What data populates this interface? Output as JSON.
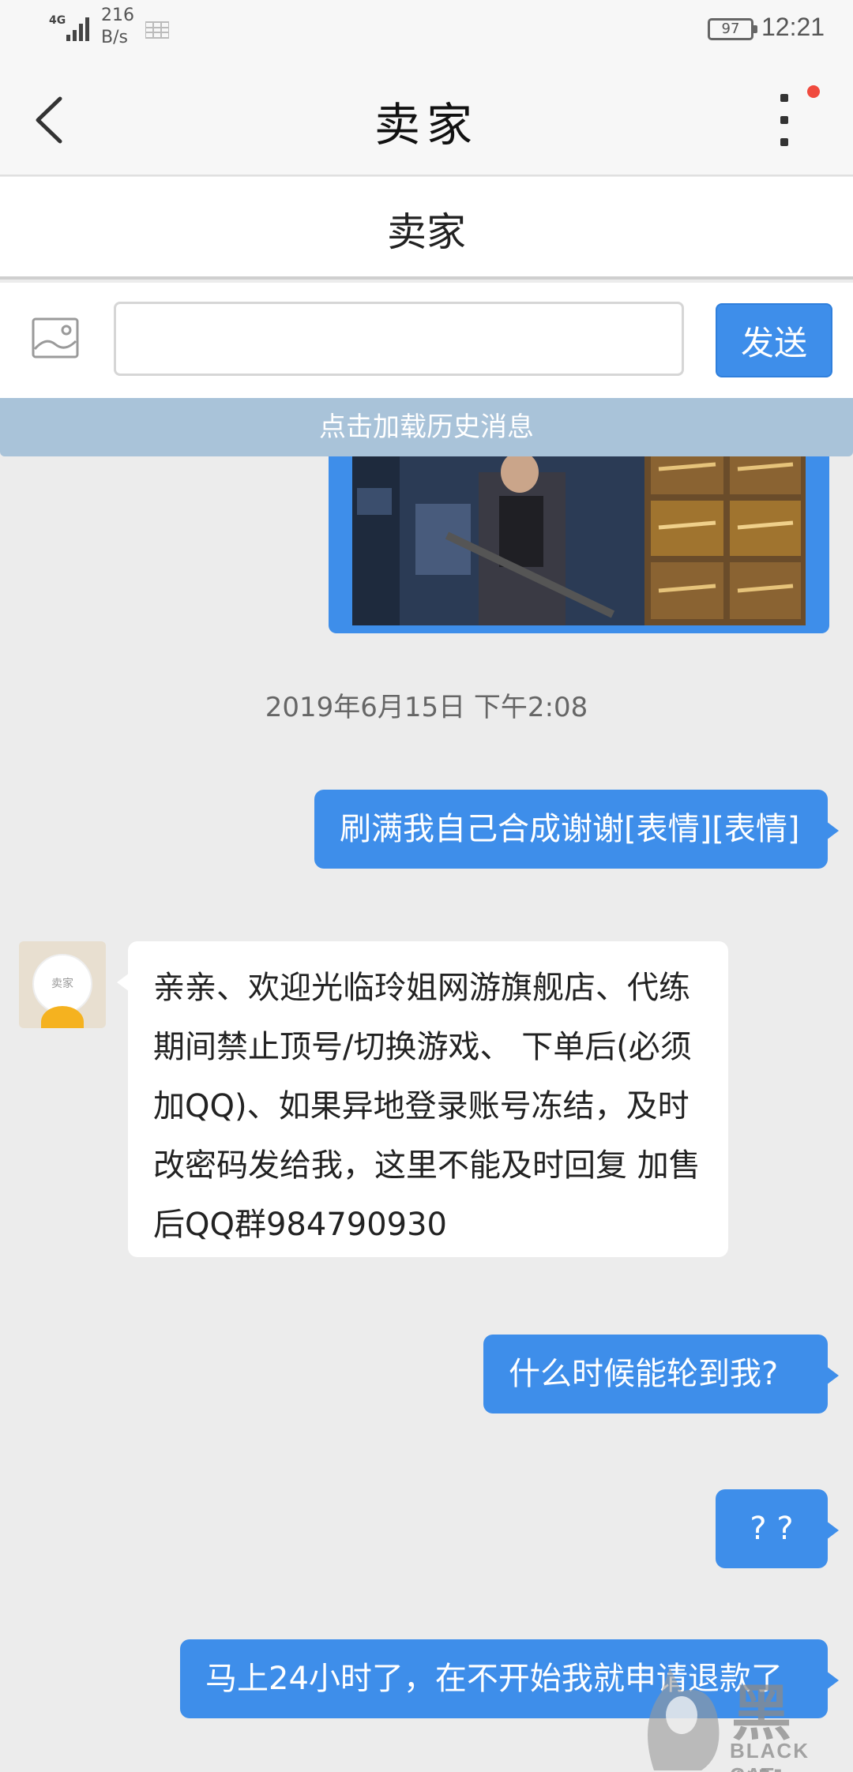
{
  "status_bar": {
    "network": "4G",
    "speed_value": "216",
    "speed_unit": "B/s",
    "battery": "97",
    "time": "12:21"
  },
  "nav": {
    "title": "卖家",
    "back_icon": "chevron-left-icon",
    "more_icon": "more-vertical-icon",
    "has_notification": true
  },
  "sub_header": {
    "title": "卖家"
  },
  "compose": {
    "image_icon": "image-icon",
    "input_value": "",
    "input_placeholder": "",
    "send_label": "发送"
  },
  "history": {
    "label": "点击加载历史消息"
  },
  "chat": {
    "timestamp": "2019年6月15日 下午2:08",
    "messages": [
      {
        "from": "me",
        "text": "刷满我自己合成谢谢[表情][表情]"
      },
      {
        "from": "seller",
        "avatar_label": "卖家",
        "text": "亲亲、欢迎光临玲姐网游旗舰店、代练期间禁止顶号/切换游戏、 下单后(必须加QQ)、如果异地登录账号冻结，及时改密码发给我，这里不能及时回复 加售后QQ群984790930"
      },
      {
        "from": "me",
        "text": "什么时候能轮到我?"
      },
      {
        "from": "me",
        "text": "? ?"
      },
      {
        "from": "me",
        "text": "马上24小时了，在不开始我就申请退款了"
      }
    ]
  },
  "watermark": {
    "text": "黑猫",
    "sub": "BLACK CAT"
  },
  "colors": {
    "accent": "#3e8eea",
    "history_bar": "#a9c3d9",
    "background": "#ececec",
    "notification": "#f04a3e"
  }
}
